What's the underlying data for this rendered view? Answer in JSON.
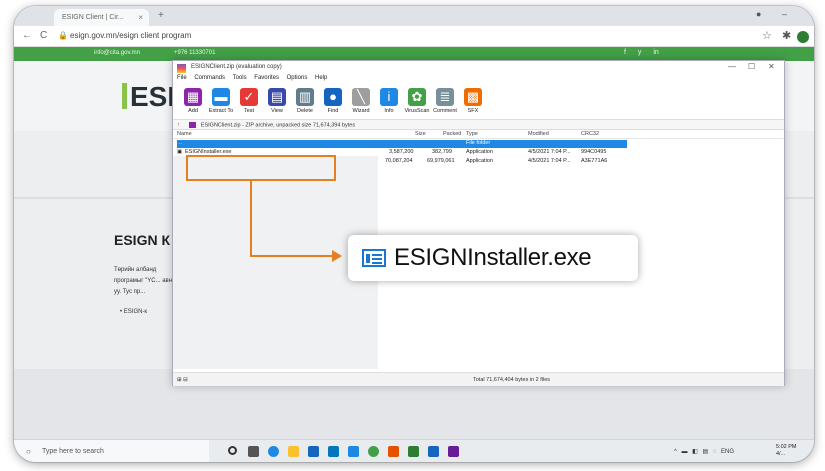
{
  "browser": {
    "tab_title": "ESIGN Client | Cir...",
    "tab_close": "×",
    "new_tab": "+",
    "url": "esign.gov.mn/esign client program",
    "nav": {
      "back": "←",
      "forward": "→",
      "reload": "C"
    }
  },
  "site": {
    "email": "info@cita.gov.mn",
    "phone": "+976 11330701",
    "social": "f  y  in",
    "logo": "ESI",
    "page_title": "ESIGN К",
    "paragraph": "Төрийн албанд програмыг \"YC... авна уу. Тус пр...",
    "bullet": "• ESIGN-к"
  },
  "winrar": {
    "title": "ESIGNClient.zip (evaluation copy)",
    "menu": [
      "File",
      "Commands",
      "Tools",
      "Favorites",
      "Options",
      "Help"
    ],
    "toolbar": [
      {
        "label": "Add",
        "icon": "add-archive-icon",
        "color": "#8e24aa"
      },
      {
        "label": "Extract To",
        "icon": "extract-folder-icon",
        "color": "#1e88e5"
      },
      {
        "label": "Test",
        "icon": "test-icon",
        "color": "#e53935"
      },
      {
        "label": "View",
        "icon": "view-book-icon",
        "color": "#3949ab"
      },
      {
        "label": "Delete",
        "icon": "delete-bin-icon",
        "color": "#607d8b"
      },
      {
        "label": "Find",
        "icon": "find-magnifier-icon",
        "color": "#1565c0"
      },
      {
        "label": "Wizard",
        "icon": "wizard-wand-icon",
        "color": "#9e9e9e"
      },
      {
        "label": "Info",
        "icon": "info-icon",
        "color": "#1e88e5"
      },
      {
        "label": "VirusScan",
        "icon": "virusscan-icon",
        "color": "#43a047"
      },
      {
        "label": "Comment",
        "icon": "comment-icon",
        "color": "#78909c"
      },
      {
        "label": "SFX",
        "icon": "sfx-icon",
        "color": "#ef6c00"
      }
    ],
    "path": "ESIGNClient.zip - ZIP archive, unpacked size 71,674,394 bytes",
    "columns": [
      "Name",
      "Size",
      "Packed",
      "Type",
      "Modified",
      "CRC32"
    ],
    "rows": [
      {
        "name": "..",
        "size": "",
        "packed": "",
        "type": "File folder",
        "modified": "",
        "crc": ""
      },
      {
        "name": "ESIGNInstaller.exe",
        "size": "3,587,200",
        "packed": "382,799",
        "type": "Application",
        "modified": "4/5/2021 7:04 P...",
        "crc": "994C0495"
      },
      {
        "name": "",
        "size": "70,087,204",
        "packed": "69,979,061",
        "type": "Application",
        "modified": "4/5/2021 7:04 P...",
        "crc": "A3E771A6"
      }
    ],
    "status": "Total 71,674,404 bytes in 2 files",
    "status_icon": "⊞ ⊟"
  },
  "callout": {
    "filename": "ESIGNInstaller.exe",
    "accent": "#e67e22"
  },
  "taskbar": {
    "search_placeholder": "Type here to search",
    "tray": "^ ▬ ◧ ▤ ◌ ENG",
    "time": "5:02 PM",
    "date": "4/..."
  }
}
